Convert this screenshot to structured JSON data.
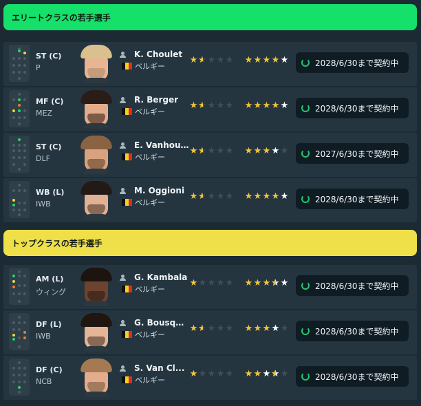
{
  "sections": [
    {
      "title": "エリートクラスの若手選手",
      "players": [
        {
          "pos": "ST (C)",
          "role": "P",
          "name": "K. Choulet",
          "nation": "ベルギー",
          "current_stars": 1.5,
          "potential_stars": 5,
          "contract": "2028/6/30まで契約中"
        },
        {
          "pos": "MF (C)",
          "role": "MEZ",
          "name": "R. Berger",
          "nation": "ベルギー",
          "current_stars": 1.5,
          "potential_stars": 5,
          "contract": "2028/6/30まで契約中"
        },
        {
          "pos": "ST (C)",
          "role": "DLF",
          "name": "E. Vanhou...",
          "nation": "ベルギー",
          "current_stars": 1.5,
          "potential_stars": 4,
          "contract": "2027/6/30まで契約中"
        },
        {
          "pos": "WB (L)",
          "role": "IWB",
          "name": "M. Oggioni",
          "nation": "ベルギー",
          "current_stars": 1.5,
          "potential_stars": 5,
          "contract": "2028/6/30まで契約中"
        }
      ]
    },
    {
      "title": "トップクラスの若手選手",
      "players": [
        {
          "pos": "AM (L)",
          "role": "ウィング",
          "name": "G. Kambala",
          "nation": "ベルギー",
          "current_stars": 1,
          "potential_stars": 4.5,
          "contract": "2028/6/30まで契約中"
        },
        {
          "pos": "DF (L)",
          "role": "IWB",
          "name": "G. Bousqu...",
          "nation": "ベルギー",
          "current_stars": 1.5,
          "potential_stars": 4,
          "contract": "2028/6/30まで契約中"
        },
        {
          "pos": "DF (C)",
          "role": "NCB",
          "name": "S. Van Cl...",
          "nation": "ベルギー",
          "current_stars": 1,
          "potential_stars": 3.5,
          "contract": "2028/6/30まで契約中"
        }
      ]
    }
  ],
  "colors": {
    "elite_header": "#14e06a",
    "top_header": "#efe04a",
    "star_gold": "#f1c538",
    "row_bg": "#243540"
  }
}
